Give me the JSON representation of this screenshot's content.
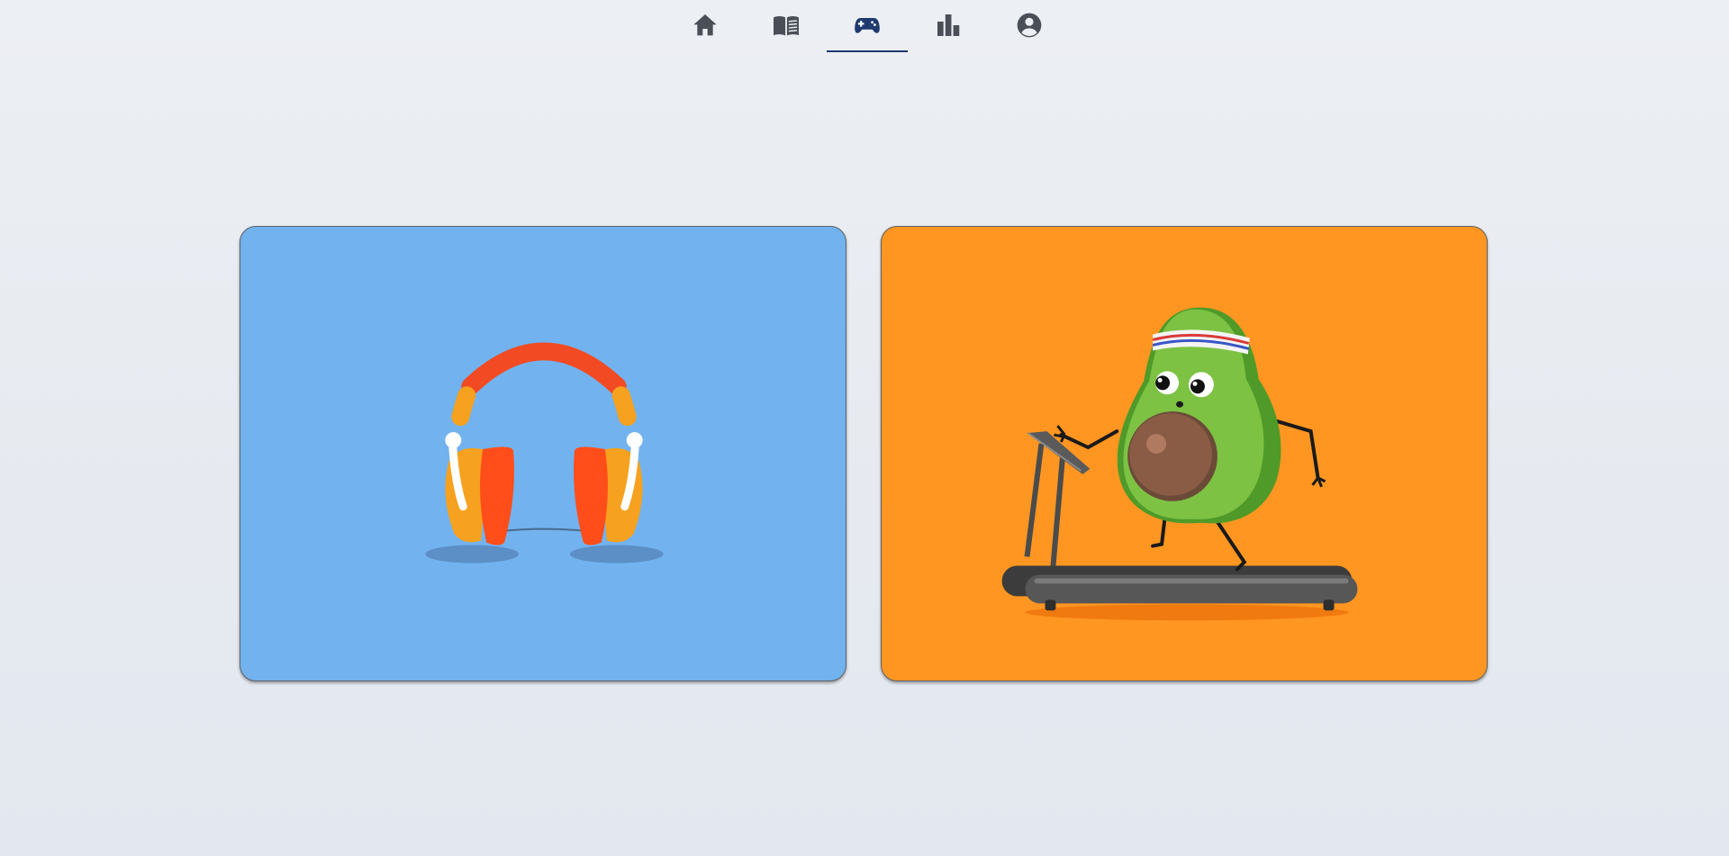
{
  "nav": {
    "active_color": "#1e3a6e",
    "icon_color": "#4a4f57",
    "tabs": [
      {
        "icon": "home-icon",
        "active": false
      },
      {
        "icon": "book-icon",
        "active": false
      },
      {
        "icon": "gamepad-icon",
        "active": true
      },
      {
        "icon": "bar-chart-icon",
        "active": false
      },
      {
        "icon": "account-icon",
        "active": false
      }
    ]
  },
  "cards": [
    {
      "illustration": "headphones-illustration",
      "background": "#72b2ef"
    },
    {
      "illustration": "avocado-on-treadmill-illustration",
      "background": "#ff9621"
    }
  ]
}
